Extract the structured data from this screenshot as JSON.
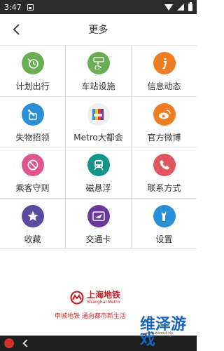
{
  "status_bar": {
    "time": "3:47"
  },
  "header": {
    "title": "更多"
  },
  "grid": [
    {
      "label": "计划出行",
      "icon": "clock-plan-icon",
      "color": "#6aae52"
    },
    {
      "label": "车站设施",
      "icon": "accessibility-facilities-icon",
      "color": "#6aae52"
    },
    {
      "label": "信息动态",
      "icon": "info-icon",
      "color": "#ee7d22"
    },
    {
      "label": "失物招领",
      "icon": "lost-and-found-icon",
      "color": "#2a8fd6"
    },
    {
      "label": "Metro大都会",
      "icon": "metro-app-icon",
      "color": "#e63a36"
    },
    {
      "label": "官方微博",
      "icon": "weibo-icon",
      "color": "#ee7d22"
    },
    {
      "label": "乘客守则",
      "icon": "no-entry-icon",
      "color": "#e05590"
    },
    {
      "label": "磁悬浮",
      "icon": "maglev-train-icon",
      "color": "#12968a"
    },
    {
      "label": "联系方式",
      "icon": "phone-icon",
      "color": "#e05560"
    },
    {
      "label": "收藏",
      "icon": "star-icon",
      "color": "#5a4aa0"
    },
    {
      "label": "交通卡",
      "icon": "transport-card-icon",
      "color": "#6a3a9a"
    },
    {
      "label": "设置",
      "icon": "wrench-settings-icon",
      "color": "#2a8fd6"
    }
  ],
  "footer": {
    "logo_cn": "上海地铁",
    "logo_en": "Shanghai Metro",
    "slogan": "申城地铁 通向都市新生活"
  },
  "watermark": {
    "text": "维泽游戏",
    "sub": "www.wizzed.vip"
  }
}
